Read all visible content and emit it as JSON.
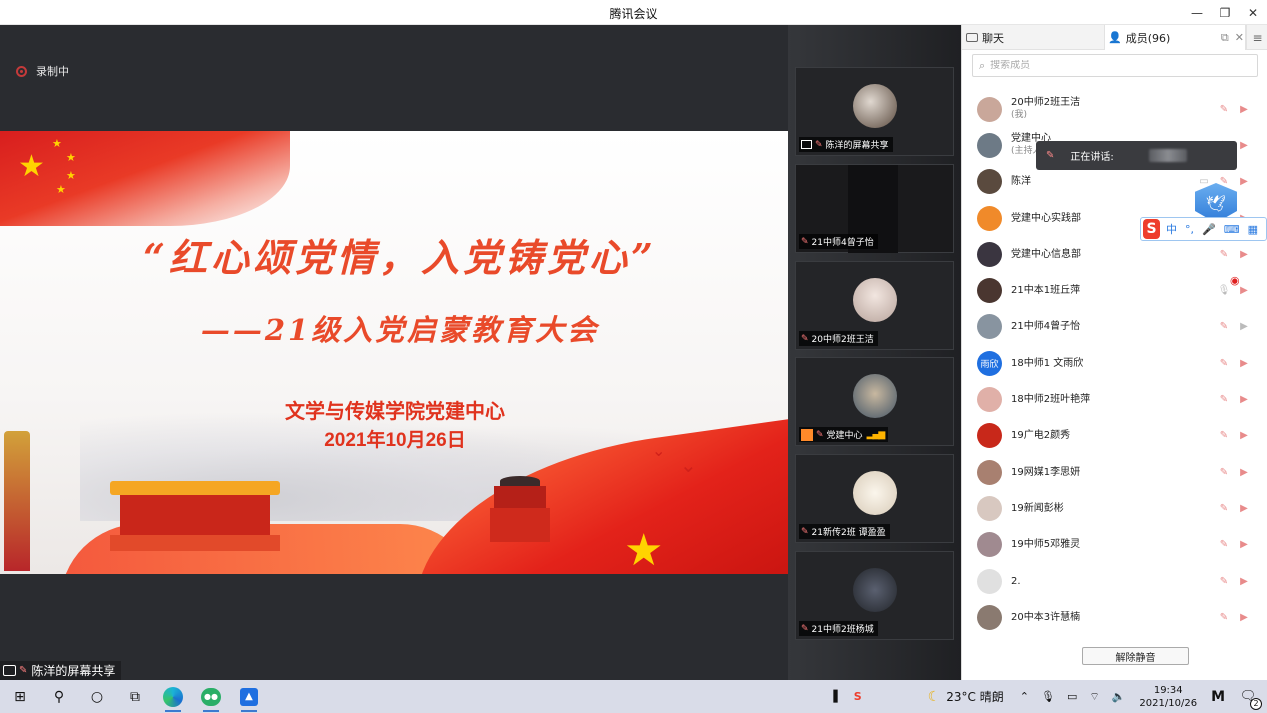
{
  "window": {
    "title": "腾讯会议",
    "minimize_icon": "minimize-icon",
    "restore_icon": "restore-icon",
    "close_icon": "close-icon"
  },
  "recording": {
    "label": "录制中"
  },
  "slide": {
    "title": "“红心颂党情，入党铸党心”",
    "subtitle": "——21级入党启蒙教育大会",
    "organizer": "文学与传媒学院党建中心",
    "date": "2021年10月26日"
  },
  "share_label": "陈洋的屏幕共享",
  "tiles": [
    {
      "label": "陈洋的屏幕共享"
    },
    {
      "label": "21中师4曾子怡"
    },
    {
      "label": "20中师2班王洁"
    },
    {
      "label": "党建中心"
    },
    {
      "label": "21新传2班 谭盈盈"
    },
    {
      "label": "21中师2班杨城"
    }
  ],
  "panel": {
    "tab_chat": "聊天",
    "tab_members": "成员(96)",
    "search_placeholder": "搜索成员",
    "members": [
      {
        "name": "20中师2班王洁",
        "tag": "(我)",
        "avatar": "#c9a79a"
      },
      {
        "name": "党建中心",
        "tag": "(主持人)",
        "avatar": "#6d7a86"
      },
      {
        "name": "陈洋",
        "tag": "",
        "avatar": "#5a4a3e"
      },
      {
        "name": "党建中心实践部",
        "tag": "",
        "avatar": "#f08a2a"
      },
      {
        "name": "党建中心信息部",
        "tag": "",
        "avatar": "#3a3540"
      },
      {
        "name": "21中本1班丘萍",
        "tag": "",
        "avatar": "#4a3630"
      },
      {
        "name": "21中师4曾子怡",
        "tag": "",
        "avatar": "#8894a0"
      },
      {
        "name": "18中师1 文雨欣",
        "tag": "",
        "avatar": "#1f6fe0",
        "initials": "雨欣"
      },
      {
        "name": "18中师2班叶艳萍",
        "tag": "",
        "avatar": "#e0b0a8"
      },
      {
        "name": "19广电2颜秀",
        "tag": "",
        "avatar": "#c8281a"
      },
      {
        "name": "19网媒1李思妍",
        "tag": "",
        "avatar": "#a88070"
      },
      {
        "name": "19新闻彭彬",
        "tag": "",
        "avatar": "#d8c8c0"
      },
      {
        "name": "19中师5邓雅灵",
        "tag": "",
        "avatar": "#a08a90"
      },
      {
        "name": "2.",
        "tag": "",
        "avatar": "#e0e0e0"
      },
      {
        "name": "20中本3许慧楠",
        "tag": "",
        "avatar": "#8a7a70"
      }
    ],
    "unmute_label": "解除静音"
  },
  "speaking_tooltip": "正在讲话:",
  "ime": {
    "logo": "S",
    "mode": "中",
    "punct": "°,",
    "mic": "🎤"
  },
  "taskbar": {
    "weather_temp": "23°C",
    "weather_desc": "晴朗",
    "time": "19:34",
    "date": "2021/10/26",
    "notif_count": "2"
  }
}
